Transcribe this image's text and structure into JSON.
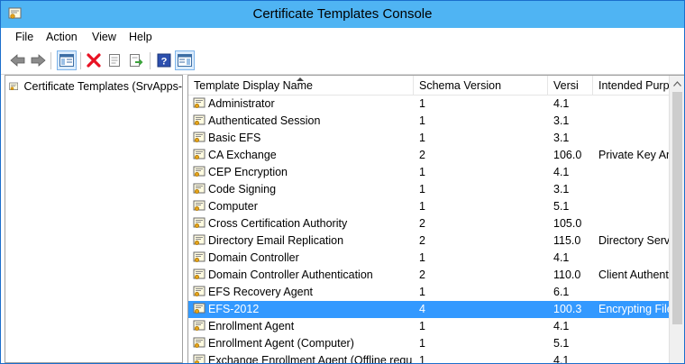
{
  "window": {
    "title": "Certificate Templates Console"
  },
  "menu": [
    {
      "label": "File"
    },
    {
      "label": "Action"
    },
    {
      "label": "View"
    },
    {
      "label": "Help"
    }
  ],
  "toolbar": [
    {
      "icon": "back-arrow-icon"
    },
    {
      "icon": "forward-arrow-icon"
    },
    {
      "icon": "show-hide-console-tree-icon"
    },
    {
      "icon": "delete-icon",
      "color": "#e81123"
    },
    {
      "icon": "properties-icon"
    },
    {
      "icon": "export-list-icon"
    },
    {
      "icon": "help-icon"
    },
    {
      "icon": "show-hide-action-pane-icon"
    }
  ],
  "tree": {
    "root_label": "Certificate Templates (SrvApps-"
  },
  "columns": [
    {
      "label": "Template Display Name"
    },
    {
      "label": "Schema Version"
    },
    {
      "label": "Versi"
    },
    {
      "label": "Intended Purpo"
    }
  ],
  "rows": [
    {
      "name": "Administrator",
      "schema": "1",
      "version": "4.1",
      "purpose": ""
    },
    {
      "name": "Authenticated Session",
      "schema": "1",
      "version": "3.1",
      "purpose": ""
    },
    {
      "name": "Basic EFS",
      "schema": "1",
      "version": "3.1",
      "purpose": ""
    },
    {
      "name": "CA Exchange",
      "schema": "2",
      "version": "106.0",
      "purpose": "Private Key Arc"
    },
    {
      "name": "CEP Encryption",
      "schema": "1",
      "version": "4.1",
      "purpose": ""
    },
    {
      "name": "Code Signing",
      "schema": "1",
      "version": "3.1",
      "purpose": ""
    },
    {
      "name": "Computer",
      "schema": "1",
      "version": "5.1",
      "purpose": ""
    },
    {
      "name": "Cross Certification Authority",
      "schema": "2",
      "version": "105.0",
      "purpose": ""
    },
    {
      "name": "Directory Email Replication",
      "schema": "2",
      "version": "115.0",
      "purpose": "Directory Servi"
    },
    {
      "name": "Domain Controller",
      "schema": "1",
      "version": "4.1",
      "purpose": ""
    },
    {
      "name": "Domain Controller Authentication",
      "schema": "2",
      "version": "110.0",
      "purpose": "Client Authent"
    },
    {
      "name": "EFS Recovery Agent",
      "schema": "1",
      "version": "6.1",
      "purpose": ""
    },
    {
      "name": "EFS-2012",
      "schema": "4",
      "version": "100.3",
      "purpose": "Encrypting File",
      "selected": true
    },
    {
      "name": "Enrollment Agent",
      "schema": "1",
      "version": "4.1",
      "purpose": ""
    },
    {
      "name": "Enrollment Agent (Computer)",
      "schema": "1",
      "version": "5.1",
      "purpose": ""
    },
    {
      "name": "Exchange Enrollment Agent (Offline requ...",
      "schema": "1",
      "version": "4.1",
      "purpose": ""
    }
  ],
  "colors": {
    "titlebar": "#4fb4f3",
    "selection": "#3399ff"
  }
}
